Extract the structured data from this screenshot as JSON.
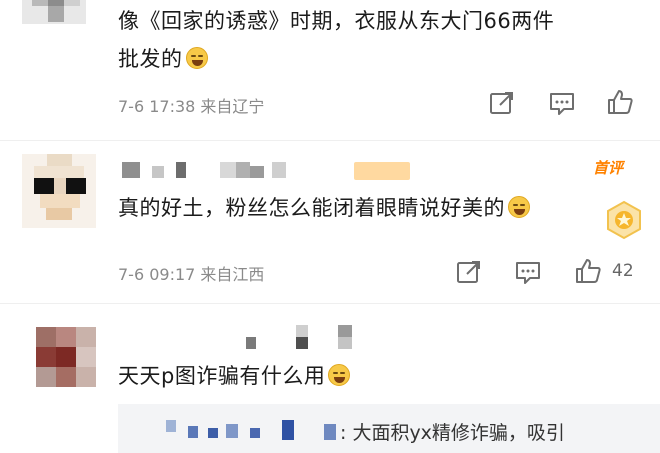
{
  "comments": [
    {
      "text": "像《回家的诱惑》时期，衣服从东大门66两件",
      "text_line2": "批发的",
      "meta": "7-6 17:38 来自辽宁",
      "likes": ""
    },
    {
      "text": "真的好土，粉丝怎么能闭着眼睛说好美的",
      "meta": "7-6 09:17 来自江西",
      "likes": "42",
      "badge": "首评"
    },
    {
      "text": "天天p图诈骗有什么用",
      "reply_preview": ": 大面积yx精修诈骗，吸引"
    }
  ],
  "icons": [
    "share-icon",
    "comment-icon",
    "like-icon",
    "medal-icon"
  ],
  "colors": {
    "accent": "#ff8200",
    "meta": "#8a8a8a",
    "icon": "#6e6e6e"
  }
}
